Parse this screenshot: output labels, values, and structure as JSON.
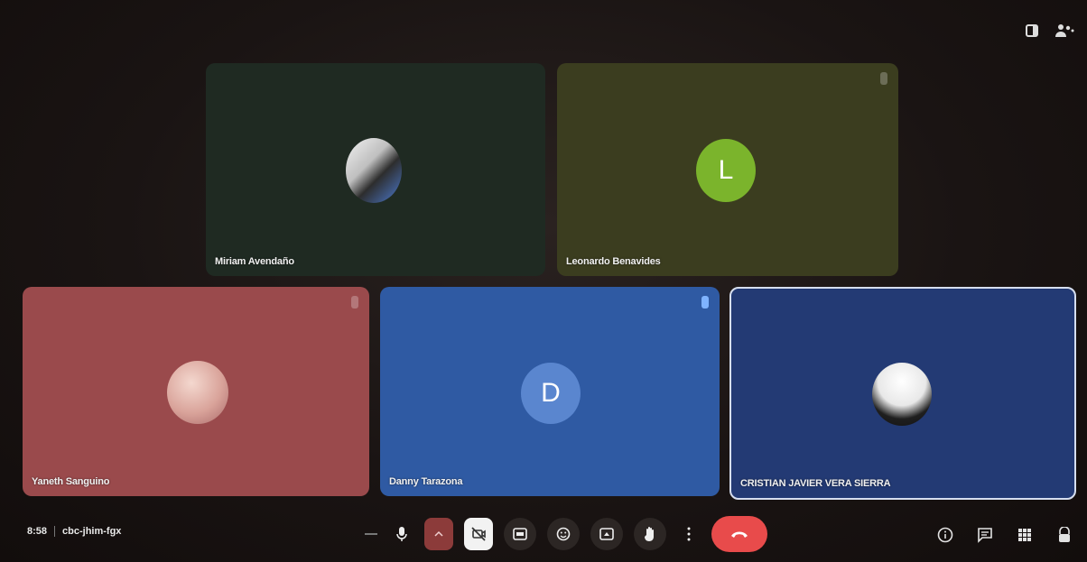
{
  "top_bar": {
    "icons": [
      "participants-panel-icon",
      "people-count-icon"
    ]
  },
  "participants": [
    {
      "name": "Miriam Avendaño",
      "avatar_type": "photo",
      "tile_color": "#1f2a22"
    },
    {
      "name": "Leonardo Benavides",
      "avatar_type": "initial",
      "initial": "L",
      "avatar_color": "#7bb42c",
      "tile_color": "#3b3d1f"
    },
    {
      "name": "Yaneth Sanguino",
      "avatar_type": "photo",
      "tile_color": "#9a4a4c"
    },
    {
      "name": "Danny Tarazona",
      "avatar_type": "initial",
      "initial": "D",
      "avatar_color": "#5a86cf",
      "tile_color": "#2f5aa3"
    },
    {
      "name": "CRISTIAN JAVIER VERA SIERRA",
      "avatar_type": "photo",
      "tile_color": "#233a74"
    }
  ],
  "meeting": {
    "time": "8:58",
    "code": "cbc-jhim-fgx"
  },
  "controls": {
    "hangup_color": "#e84b4b",
    "items": [
      "microphone-icon",
      "expand-icon",
      "camera-off-icon",
      "captions-icon",
      "emoji-icon",
      "present-icon",
      "raise-hand-icon",
      "more-options-icon",
      "hangup-icon"
    ]
  },
  "side_controls": [
    "info-icon",
    "chat-icon",
    "activities-icon",
    "host-controls-icon"
  ]
}
